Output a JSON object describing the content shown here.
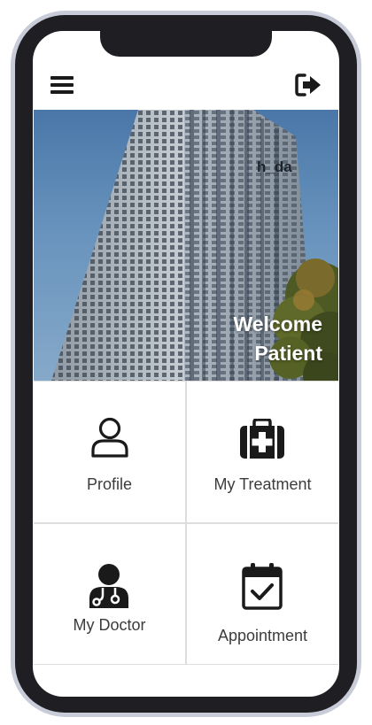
{
  "header": {
    "menu_icon": "hamburger-menu-icon",
    "logout_icon": "sign-out-icon"
  },
  "hero": {
    "building_sign": "h_da",
    "welcome_line1": "Welcome",
    "welcome_line2": "Patient"
  },
  "tiles": [
    {
      "label": "Profile",
      "icon": "user-icon"
    },
    {
      "label": "My Treatment",
      "icon": "medical-kit-icon"
    },
    {
      "label": "My Doctor",
      "icon": "doctor-icon"
    },
    {
      "label": "Appointment",
      "icon": "calendar-check-icon"
    }
  ],
  "colors": {
    "phone_frame": "#1f1f23",
    "phone_bezel": "#c8ccd8",
    "icon": "#1a1a1a",
    "text": "#3c3c3c",
    "divider": "#dddddd"
  }
}
